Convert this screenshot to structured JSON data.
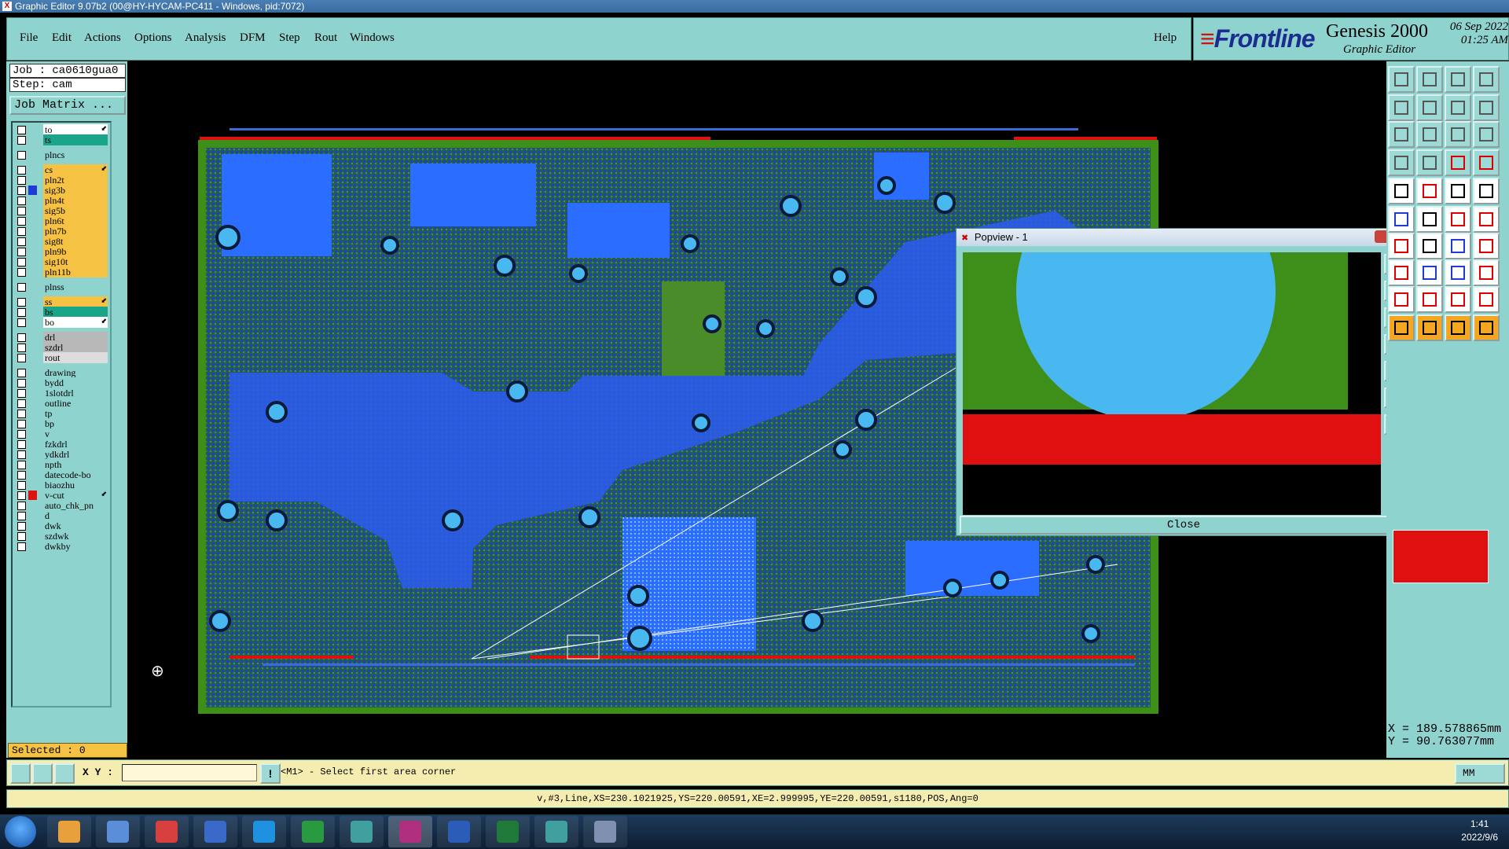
{
  "window": {
    "title": "Graphic Editor 9.07b2 (00@HY-HYCAM-PC411 - Windows, pid:7072)"
  },
  "menu": {
    "file": "File",
    "edit": "Edit",
    "actions": "Actions",
    "options": "Options",
    "analysis": "Analysis",
    "dfm": "DFM",
    "step": "Step",
    "rout": "Rout",
    "windows": "Windows",
    "help": "Help"
  },
  "brand": {
    "logo": "Frontline",
    "product": "Genesis 2000",
    "subtitle": "Graphic Editor",
    "date": "06 Sep 2022",
    "time": "01:25 AM"
  },
  "job": {
    "job_label": "Job : ca0610gua0",
    "step_label": "Step: cam",
    "matrix_button": "Job Matrix ..."
  },
  "layers": [
    {
      "name": "to",
      "color": "#ffffff",
      "arrow": "⬋"
    },
    {
      "name": "ts",
      "color": "#1aa58a"
    },
    {
      "name": "plncs",
      "color": "#8fd3cf"
    },
    {
      "name": "cs",
      "color": "#f5c243",
      "arrow": "⬋"
    },
    {
      "name": "pln2t",
      "color": "#f5c243"
    },
    {
      "name": "sig3b",
      "color": "#f5c243",
      "swatch": "#1d3bd6"
    },
    {
      "name": "pln4t",
      "color": "#f5c243"
    },
    {
      "name": "sig5b",
      "color": "#f5c243"
    },
    {
      "name": "pln6t",
      "color": "#f5c243"
    },
    {
      "name": "pln7b",
      "color": "#f5c243"
    },
    {
      "name": "sig8t",
      "color": "#f5c243"
    },
    {
      "name": "pln9b",
      "color": "#f5c243"
    },
    {
      "name": "sig10t",
      "color": "#f5c243"
    },
    {
      "name": "pln11b",
      "color": "#f5c243"
    },
    {
      "name": "plnss",
      "color": "#8fd3cf"
    },
    {
      "name": "ss",
      "color": "#f5c243",
      "arrow": "⬋"
    },
    {
      "name": "bs",
      "color": "#1aa58a"
    },
    {
      "name": "bo",
      "color": "#ffffff",
      "arrow": "⬋"
    },
    {
      "name": "drl",
      "color": "#b8b8b8"
    },
    {
      "name": "szdrl",
      "color": "#b8b8b8"
    },
    {
      "name": "rout",
      "color": "#dddddd"
    },
    {
      "name": "drawing",
      "color": "#8fd3cf"
    },
    {
      "name": "bydd",
      "color": "#8fd3cf"
    },
    {
      "name": "1slotdrl",
      "color": "#8fd3cf"
    },
    {
      "name": "outline",
      "color": "#8fd3cf"
    },
    {
      "name": "tp",
      "color": "#8fd3cf"
    },
    {
      "name": "bp",
      "color": "#8fd3cf"
    },
    {
      "name": "v",
      "color": "#8fd3cf"
    },
    {
      "name": "fzkdrl",
      "color": "#8fd3cf"
    },
    {
      "name": "ydkdrl",
      "color": "#8fd3cf"
    },
    {
      "name": "npth",
      "color": "#8fd3cf"
    },
    {
      "name": "datecode-bo",
      "color": "#8fd3cf"
    },
    {
      "name": "biaozhu",
      "color": "#8fd3cf"
    },
    {
      "name": "v-cut",
      "color": "#8fd3cf",
      "swatch": "#e01010",
      "arrow": "⬋"
    },
    {
      "name": "auto_chk_pn",
      "color": "#8fd3cf"
    },
    {
      "name": "d",
      "color": "#8fd3cf"
    },
    {
      "name": "dwk",
      "color": "#8fd3cf"
    },
    {
      "name": "szdwk",
      "color": "#8fd3cf"
    },
    {
      "name": "dwkby",
      "color": "#8fd3cf"
    }
  ],
  "status": {
    "selected": "Selected : 0",
    "xy_label": "X Y :",
    "xy_value": "",
    "prompt": "<M1> - Select first area corner",
    "unit": "MM",
    "info": "v,#3,Line,XS=230.1021925,YS=220.00591,XE=2.999995,YE=220.00591,s1180,POS,Ang=0"
  },
  "coords": {
    "x": "X = 189.578865mm",
    "y": "Y = 90.763077mm"
  },
  "popview": {
    "title": "Popview - 1",
    "close_label": "Close"
  },
  "taskbar": {
    "time": "1:41",
    "date": "2022/9/6"
  },
  "colors": {
    "panel": "#8fd3cf",
    "board_green": "#3e8f1a",
    "copper_blue": "#1d3bd6",
    "pad_cyan": "#4ab8f0",
    "outline_red": "#e01010",
    "selected_bg": "#f5c243"
  }
}
